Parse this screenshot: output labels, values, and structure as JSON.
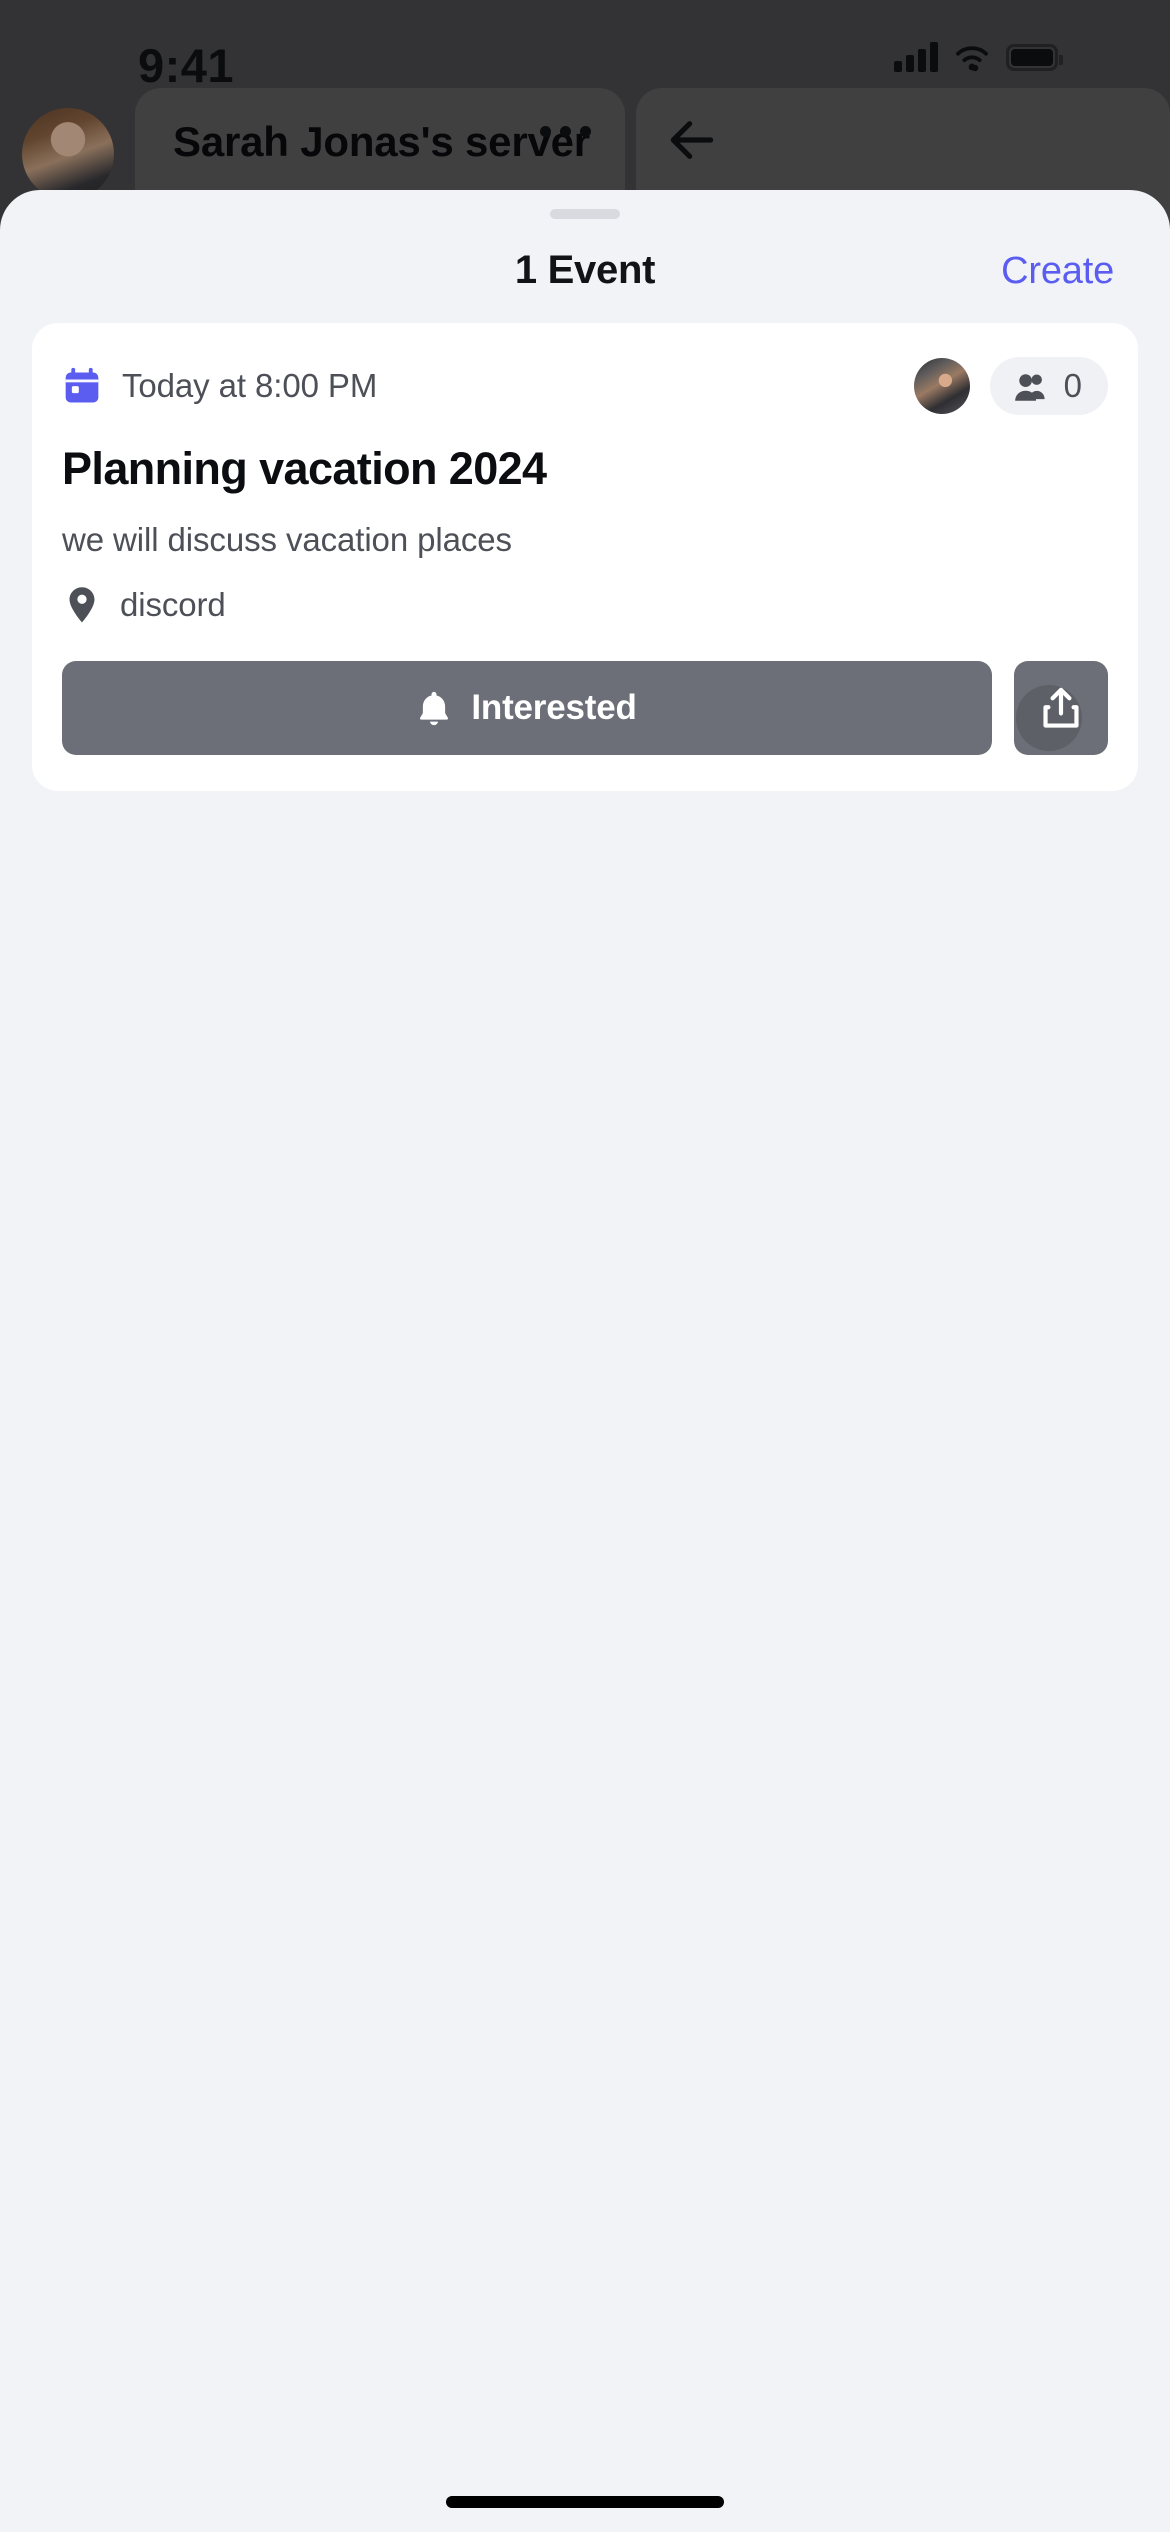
{
  "status_bar": {
    "time": "9:41",
    "icons": [
      "cellular-signal-icon",
      "wifi-icon",
      "battery-icon"
    ]
  },
  "background_app": {
    "server_name": "Sarah Jonas's server",
    "more_icon": "overflow-menu-icon",
    "back_icon": "back-arrow-icon",
    "avatar": "server-avatar"
  },
  "sheet": {
    "grabber": "sheet-grabber",
    "title": "1 Event",
    "create_label": "Create"
  },
  "event": {
    "calendar_icon": "calendar-icon",
    "when": "Today at 8:00 PM",
    "host_avatar": "host-avatar",
    "attendee_icon": "people-icon",
    "attendee_count": "0",
    "title": "Planning vacation 2024",
    "description": "we will discuss vacation places",
    "location_icon": "location-pin-icon",
    "location": "discord",
    "interested_icon": "bell-icon",
    "interested_label": "Interested",
    "share_icon": "share-icon"
  },
  "colors": {
    "accent_blurple": "#5a5df0",
    "sheet_background": "#f2f3f7",
    "card_background": "#ffffff",
    "button_gray": "#6d6f78",
    "text_primary": "#0c0d10",
    "text_secondary": "#4e5058"
  }
}
